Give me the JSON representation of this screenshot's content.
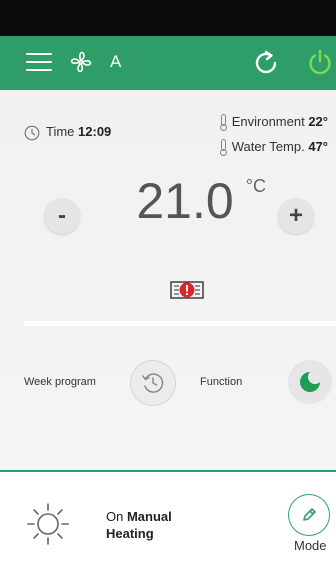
{
  "header": {
    "fan_speed_letter": "A",
    "icons": [
      "menu-icon",
      "fan-icon",
      "refresh-icon",
      "power-icon"
    ]
  },
  "info": {
    "time_label": "Time",
    "time_value": "12:09",
    "environment_label": "Environment",
    "environment_value": "22°",
    "water_label": "Water Temp.",
    "water_value": "47°"
  },
  "setpoint": {
    "value": "21.0",
    "unit": "°C",
    "minus_label": "-",
    "plus_label": "+"
  },
  "program": {
    "week_label": "Week program",
    "function_label": "Function"
  },
  "status": {
    "prefix": "On",
    "mode_name": "Manual",
    "activity": "Heating",
    "mode_button_label": "Mode"
  },
  "colors": {
    "brand_green": "#2f9d67",
    "power_green": "#7ed957",
    "alarm_red": "#e0242b",
    "background_gray": "#f2f2f2"
  }
}
